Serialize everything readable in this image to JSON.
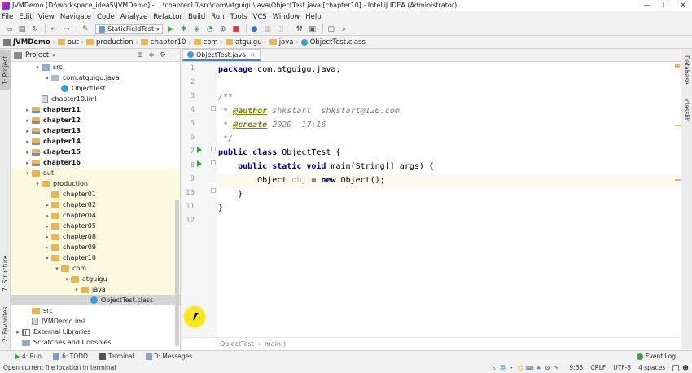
{
  "window": {
    "title": "JVMDemo [D:\\workspace_idea5\\JVMDemo] - ...\\chapter10\\src\\com\\atguigu\\java\\ObjectTest.java [chapter10] - IntelliJ IDEA (Administrator)",
    "minimize": "—",
    "maximize": "☐",
    "close": "✕"
  },
  "menu": [
    "File",
    "Edit",
    "View",
    "Navigate",
    "Code",
    "Analyze",
    "Refactor",
    "Build",
    "Run",
    "Tools",
    "VCS",
    "Window",
    "Help"
  ],
  "toolbar": {
    "run_config": "StaticFieldTest",
    "icons": [
      "save-icon",
      "sync-icon",
      "back-icon",
      "forward-icon",
      "build-icon",
      "run-icon",
      "debug-icon",
      "coverage-icon",
      "profile-icon",
      "stop-icon",
      "search-everywhere-icon"
    ]
  },
  "breadcrumb": [
    "JVMDemo",
    "out",
    "production",
    "chapter10",
    "com",
    "atguigu",
    "java",
    "ObjectTest.class"
  ],
  "project_panel": {
    "title": "Project",
    "tree": [
      {
        "label": "src",
        "indent": 2,
        "icon": "folder-blue",
        "arrow": "▾"
      },
      {
        "label": "com.atguigu.java",
        "indent": 3,
        "icon": "package",
        "arrow": "▾"
      },
      {
        "label": "ObjectTest",
        "indent": 4,
        "icon": "class",
        "arrow": ""
      },
      {
        "label": "chapter10.iml",
        "indent": 2,
        "icon": "iml",
        "arrow": ""
      },
      {
        "label": "chapter11",
        "indent": 1,
        "icon": "module",
        "arrow": "▸",
        "bold": true
      },
      {
        "label": "chapter12",
        "indent": 1,
        "icon": "module",
        "arrow": "▸",
        "bold": true
      },
      {
        "label": "chapter13",
        "indent": 1,
        "icon": "module",
        "arrow": "▸",
        "bold": true
      },
      {
        "label": "chapter14",
        "indent": 1,
        "icon": "module",
        "arrow": "▸",
        "bold": true
      },
      {
        "label": "chapter15",
        "indent": 1,
        "icon": "module",
        "arrow": "▸",
        "bold": true
      },
      {
        "label": "chapter16",
        "indent": 1,
        "icon": "module",
        "arrow": "▸",
        "bold": true
      },
      {
        "label": "out",
        "indent": 1,
        "icon": "folder",
        "arrow": "▾",
        "hl": true
      },
      {
        "label": "production",
        "indent": 2,
        "icon": "folder",
        "arrow": "▾",
        "hl": true
      },
      {
        "label": "chapter01",
        "indent": 3,
        "icon": "folder",
        "arrow": "",
        "hl": true
      },
      {
        "label": "chapter02",
        "indent": 3,
        "icon": "folder",
        "arrow": "▸",
        "hl": true
      },
      {
        "label": "chapter04",
        "indent": 3,
        "icon": "folder",
        "arrow": "▸",
        "hl": true
      },
      {
        "label": "chapter05",
        "indent": 3,
        "icon": "folder",
        "arrow": "▸",
        "hl": true
      },
      {
        "label": "chapter08",
        "indent": 3,
        "icon": "folder",
        "arrow": "▸",
        "hl": true
      },
      {
        "label": "chapter09",
        "indent": 3,
        "icon": "folder",
        "arrow": "▸",
        "hl": true
      },
      {
        "label": "chapter10",
        "indent": 3,
        "icon": "folder",
        "arrow": "▾",
        "hl": true
      },
      {
        "label": "com",
        "indent": 4,
        "icon": "folder",
        "arrow": "▾",
        "hl": true
      },
      {
        "label": "atguigu",
        "indent": 5,
        "icon": "folder",
        "arrow": "▾",
        "hl": true
      },
      {
        "label": "java",
        "indent": 6,
        "icon": "folder",
        "arrow": "▾",
        "hl": true
      },
      {
        "label": "ObjectTest.class",
        "indent": 7,
        "icon": "class",
        "arrow": "",
        "sel": true
      },
      {
        "label": "src",
        "indent": 1,
        "icon": "folder",
        "arrow": ""
      },
      {
        "label": "JVMDemo.iml",
        "indent": 1,
        "icon": "iml",
        "arrow": ""
      },
      {
        "label": "External Libraries",
        "indent": 0,
        "icon": "library",
        "arrow": "▸"
      },
      {
        "label": "Scratches and Consoles",
        "indent": 0,
        "icon": "scratch",
        "arrow": ""
      }
    ]
  },
  "left_tabs": [
    "1: Project",
    "7: Structure",
    "2: Favorites"
  ],
  "right_tabs": [
    "Database",
    "classlib"
  ],
  "editor": {
    "tab_label": "ObjectTest.java",
    "line_numbers": [
      "1",
      "2",
      "3",
      "4",
      "5",
      "6",
      "7",
      "8",
      "9",
      "10",
      "11",
      "12"
    ],
    "lines": [
      [
        {
          "t": "package",
          "c": "kw"
        },
        {
          "t": " com.atguigu.java;",
          "c": "plain"
        }
      ],
      [],
      [
        {
          "t": "/**",
          "c": "cm"
        }
      ],
      [
        {
          "t": " * ",
          "c": "cm"
        },
        {
          "t": "@author",
          "c": "tag"
        },
        {
          "t": " shkstart  shkstart@126.com",
          "c": "cm"
        }
      ],
      [
        {
          "t": " * ",
          "c": "cm"
        },
        {
          "t": "@create",
          "c": "tag"
        },
        {
          "t": " 2020  17:16",
          "c": "cm"
        }
      ],
      [
        {
          "t": " */",
          "c": "cm"
        }
      ],
      [
        {
          "t": "public class",
          "c": "kw"
        },
        {
          "t": " ObjectTest {",
          "c": "plain"
        }
      ],
      [
        {
          "t": "    public static void",
          "c": "kw"
        },
        {
          "t": " main(String[] args) {",
          "c": "plain"
        }
      ],
      [
        {
          "t": "        Object ",
          "c": "plain"
        },
        {
          "t": "obj",
          "c": "var"
        },
        {
          "t": " = ",
          "c": "plain"
        },
        {
          "t": "new",
          "c": "kw"
        },
        {
          "t": " Object();",
          "c": "plain"
        }
      ],
      [
        {
          "t": "    }",
          "c": "plain"
        }
      ],
      [
        {
          "t": "}",
          "c": "plain"
        }
      ],
      []
    ],
    "breadcrumb": [
      "ObjectTest",
      "main()"
    ]
  },
  "bottom_tabs": [
    "4: Run",
    "6: TODO",
    "Terminal",
    "0: Messages"
  ],
  "event_log": "Event Log",
  "status": {
    "message": "Open current file location in terminal",
    "ime": [
      "S",
      "英",
      "・",
      "☺",
      "⌨",
      "♣",
      "⚙",
      "✎"
    ],
    "position": "9:35",
    "line_sep": "CRLF",
    "encoding": "UTF-8",
    "indent": "4 spaces"
  }
}
